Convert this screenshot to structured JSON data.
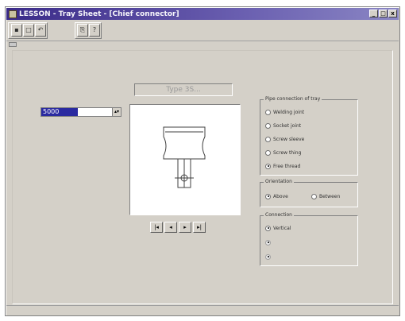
{
  "window": {
    "title": "LESSON - Tray Sheet - [Chief connector]",
    "minimize": "_",
    "maximize": "□",
    "close": "x"
  },
  "toolbar": {
    "buttons": [
      {
        "name": "print-icon",
        "glyph": "▪"
      },
      {
        "name": "document-icon",
        "glyph": "□"
      },
      {
        "name": "back-icon",
        "glyph": "↶"
      },
      {
        "name": "copy-icon",
        "glyph": "⎘"
      },
      {
        "name": "help-icon",
        "glyph": "?"
      }
    ]
  },
  "type_label": "Type 3S...",
  "combo": {
    "value": "5000",
    "arrow": "▴▾"
  },
  "navigation": [
    {
      "name": "first-button",
      "glyph": "|◂"
    },
    {
      "name": "prev-button",
      "glyph": "◂"
    },
    {
      "name": "next-button",
      "glyph": "▸"
    },
    {
      "name": "last-button",
      "glyph": "▸|"
    }
  ],
  "groups": {
    "connector": {
      "title": "Pipe connection of tray",
      "options": [
        {
          "label": "Welding joint",
          "checked": false
        },
        {
          "label": "Socket joint",
          "checked": false
        },
        {
          "label": "Screw sleeve",
          "checked": false
        },
        {
          "label": "Screw thing",
          "checked": false
        },
        {
          "label": "Free thread",
          "checked": true
        }
      ]
    },
    "orientation": {
      "title": "Orientation",
      "options": [
        {
          "label": "Above",
          "checked": true
        },
        {
          "label": "Between",
          "checked": false
        }
      ]
    },
    "connection": {
      "title": "Connection",
      "options": [
        {
          "label": "Vertical",
          "checked": true,
          "enabled": true
        },
        {
          "label": "",
          "checked": false,
          "enabled": false
        },
        {
          "label": "",
          "checked": false,
          "enabled": false
        }
      ]
    }
  }
}
